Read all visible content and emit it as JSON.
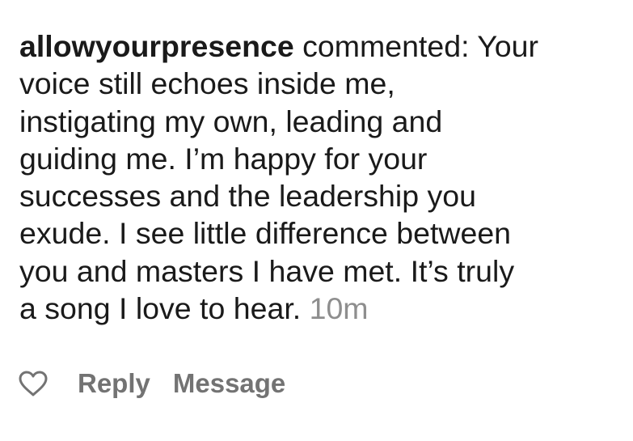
{
  "comment": {
    "username": "allowyourpresence",
    "action_text": "commented:",
    "line1_tail": "Your",
    "line2": "voice still echoes inside me,",
    "line3": "instigating my own, leading and",
    "line4": "guiding me. I’m happy for your",
    "line5": "successes and the leadership you",
    "line6": "exude. I see little difference between",
    "line7": "you and masters I have met. It’s truly",
    "line8": "a song I love to hear.",
    "timestamp": "10m"
  },
  "actions": {
    "like_icon": "heart-outline-icon",
    "reply_label": "Reply",
    "message_label": "Message"
  },
  "colors": {
    "text": "#1a1a1a",
    "muted": "#8e8e8e",
    "action": "#737373"
  }
}
